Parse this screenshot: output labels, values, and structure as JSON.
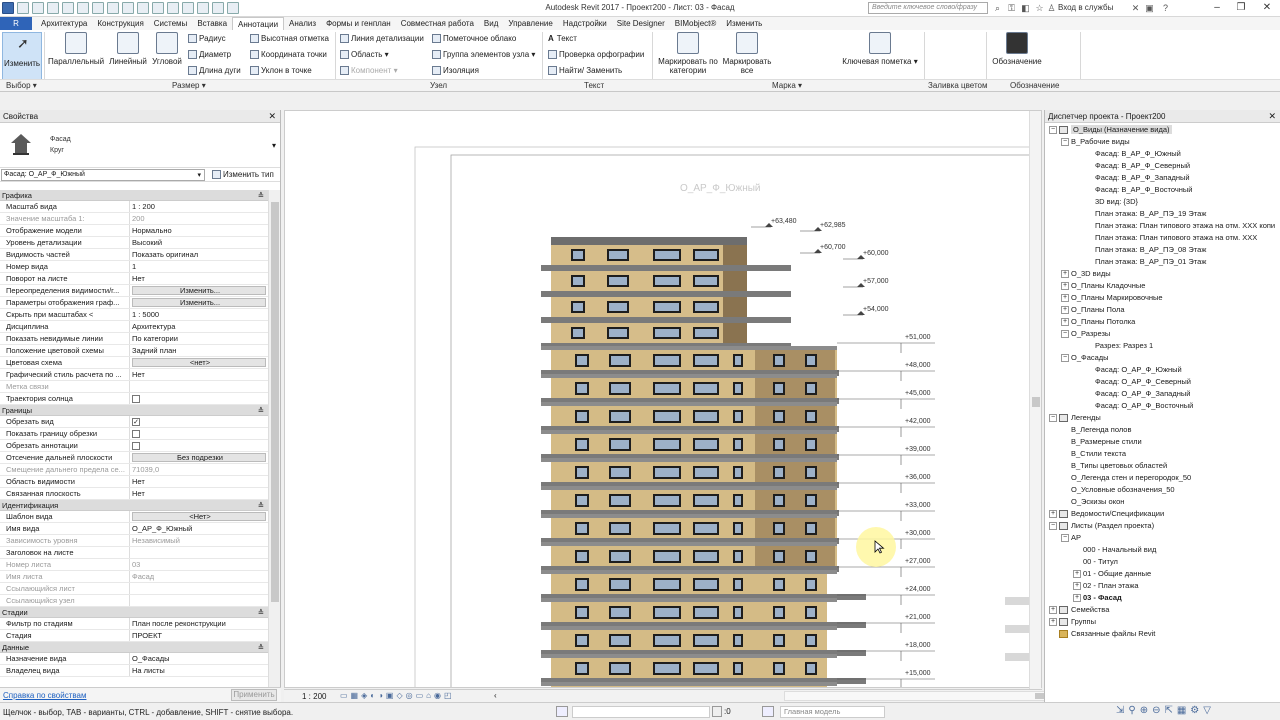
{
  "window": {
    "title": "Autodesk Revit 2017 -    Проект200 - Лист: 03 - Фасад",
    "search_placeholder": "Введите ключевое слово/фразу",
    "sign_in": "Вход в службы"
  },
  "file_tab": "R",
  "tabs": [
    "Архитектура",
    "Конструкция",
    "Системы",
    "Вставка",
    "Аннотации",
    "Анализ",
    "Формы и генплан",
    "Совместная работа",
    "Вид",
    "Управление",
    "Надстройки",
    "Site Designer",
    "BIMobject®",
    "Изменить"
  ],
  "active_tab": "Аннотации",
  "ribbon": {
    "modify": "Изменить",
    "dimension_buttons": [
      "Параллельный",
      "Линейный",
      "Угловой"
    ],
    "dim_small": [
      "Радиус",
      "Диаметр",
      "Длина дуги"
    ],
    "spot_small": [
      "Высотная отметка",
      "Координата точки",
      "Уклон  в точке"
    ],
    "detail_small": [
      "Линия детализации",
      "Область",
      "Компонент"
    ],
    "detail_small2": [
      "Пометочное облако",
      "Группа элементов узла",
      "Изоляция"
    ],
    "text_small": [
      "Текст",
      "Проверка  орфографии",
      "Найти/ Заменить"
    ],
    "tag_big": [
      "Маркировать по категории",
      "Маркировать все"
    ],
    "keynote": "Ключевая пометка",
    "legend": "Обозначение",
    "panels": {
      "select": "Выбор",
      "dimension": "Размер",
      "detail": "Узел",
      "text": "Текст",
      "tag": "Марка",
      "color_fill": "Заливка цветом",
      "symbol": "Обозначение"
    }
  },
  "properties": {
    "title": "Свойства",
    "type_line1": "Фасад",
    "type_line2": "Круг",
    "instance": "Фасад: О_АР_Ф_Южный",
    "edit_type": "Изменить тип",
    "help_link": "Справка по свойствам",
    "apply": "Применить",
    "sections": [
      {
        "name": "Графика",
        "rows": [
          {
            "n": "Масштаб вида",
            "v": "1 : 200"
          },
          {
            "n": "Значение масштаба    1:",
            "v": "200",
            "gray": true
          },
          {
            "n": "Отображение модели",
            "v": "Нормально"
          },
          {
            "n": "Уровень детализации",
            "v": "Высокий"
          },
          {
            "n": "Видимость частей",
            "v": "Показать оригинал"
          },
          {
            "n": "Номер вида",
            "v": "1"
          },
          {
            "n": "Поворот на листе",
            "v": "Нет"
          },
          {
            "n": "Переопределения видимости/г...",
            "v": "Изменить...",
            "btn": true
          },
          {
            "n": "Параметры отображения граф...",
            "v": "Изменить...",
            "btn": true
          },
          {
            "n": "Скрыть при масштабах <",
            "v": "1 : 5000"
          },
          {
            "n": "Дисциплина",
            "v": "Архитектура"
          },
          {
            "n": "Показать невидимые линии",
            "v": "По категории"
          },
          {
            "n": "Положение цветовой схемы",
            "v": "Задний план"
          },
          {
            "n": "Цветовая схема",
            "v": "<нет>",
            "btn": true
          },
          {
            "n": "Графический стиль расчета по ...",
            "v": "Нет"
          },
          {
            "n": "Метка связи",
            "v": "",
            "gray": true
          },
          {
            "n": "Траектория солнца",
            "v": "",
            "chk": false
          }
        ]
      },
      {
        "name": "Границы",
        "rows": [
          {
            "n": "Обрезать вид",
            "v": "",
            "chk": true
          },
          {
            "n": "Показать границу обрезки",
            "v": "",
            "chk": false
          },
          {
            "n": "Обрезать аннотации",
            "v": "",
            "chk": false
          },
          {
            "n": "Отсечение дальней плоскости",
            "v": "Без подрезки",
            "btn": true
          },
          {
            "n": "Смещение дальнего предела се...",
            "v": "71039,0",
            "gray": true
          },
          {
            "n": "Область видимости",
            "v": "Нет"
          },
          {
            "n": "Связанная плоскость",
            "v": "Нет"
          }
        ]
      },
      {
        "name": "Идентификация",
        "rows": [
          {
            "n": "Шаблон вида",
            "v": "<Нет>",
            "btn": true
          },
          {
            "n": "Имя вида",
            "v": "О_АР_Ф_Южный"
          },
          {
            "n": "Зависимость уровня",
            "v": "Независимый",
            "gray": true
          },
          {
            "n": "Заголовок на листе",
            "v": ""
          },
          {
            "n": "Номер листа",
            "v": "03",
            "gray": true
          },
          {
            "n": "Имя листа",
            "v": "Фасад",
            "gray": true
          },
          {
            "n": "Ссылающийся лист",
            "v": "",
            "gray": true
          },
          {
            "n": "Ссылающийся узел",
            "v": "",
            "gray": true
          }
        ]
      },
      {
        "name": "Стадии",
        "rows": [
          {
            "n": "Фильтр по стадиям",
            "v": "План после реконструкции"
          },
          {
            "n": "Стадия",
            "v": "ПРОЕКТ"
          }
        ]
      },
      {
        "name": "Данные",
        "rows": [
          {
            "n": "Назначение вида",
            "v": "О_Фасады"
          },
          {
            "n": "Владелец вида",
            "v": "На листы"
          }
        ]
      }
    ]
  },
  "drawing": {
    "view_title": "О_АР_Ф_Южный",
    "levels_upper": [
      "+63,480",
      "+62,985",
      "+60,700",
      "+60,000",
      "+57,000",
      "+54,000"
    ],
    "levels_lower": [
      "+51,000",
      "+48,000",
      "+45,000",
      "+42,000",
      "+39,000",
      "+36,000",
      "+33,000",
      "+30,000",
      "+27,000",
      "+24,000",
      "+21,000",
      "+18,000",
      "+15,000"
    ],
    "scale": "1 : 200"
  },
  "browser": {
    "title": "Диспетчер проекта - Проект200",
    "items": [
      {
        "t": "О_Виды (Назначение вида)",
        "lvl": 0,
        "tog": "-",
        "ico": true,
        "sel": true
      },
      {
        "t": "В_Рабочие виды",
        "lvl": 1,
        "tog": "-"
      },
      {
        "t": "Фасад: В_АР_Ф_Южный",
        "lvl": 3
      },
      {
        "t": "Фасад: В_АР_Ф_Северный",
        "lvl": 3
      },
      {
        "t": "Фасад: В_АР_Ф_Западный",
        "lvl": 3
      },
      {
        "t": "Фасад: В_АР_Ф_Восточный",
        "lvl": 3
      },
      {
        "t": "3D вид: {3D}",
        "lvl": 3
      },
      {
        "t": "План этажа: В_АР_ПЭ_19 Этаж",
        "lvl": 3
      },
      {
        "t": "План этажа: План типового этажа на отм. XXX копи",
        "lvl": 3
      },
      {
        "t": "План этажа: План типового этажа на отм. XXX",
        "lvl": 3
      },
      {
        "t": "План этажа: В_АР_ПЭ_08 Этаж",
        "lvl": 3
      },
      {
        "t": "План этажа: В_АР_ПЭ_01 Этаж",
        "lvl": 3
      },
      {
        "t": "О_3D виды",
        "lvl": 1,
        "tog": "+"
      },
      {
        "t": "О_Планы Кладочные",
        "lvl": 1,
        "tog": "+"
      },
      {
        "t": "О_Планы Маркировочные",
        "lvl": 1,
        "tog": "+"
      },
      {
        "t": "О_Планы Пола",
        "lvl": 1,
        "tog": "+"
      },
      {
        "t": "О_Планы Потолка",
        "lvl": 1,
        "tog": "+"
      },
      {
        "t": "О_Разрезы",
        "lvl": 1,
        "tog": "-"
      },
      {
        "t": "Разрез: Разрез 1",
        "lvl": 3
      },
      {
        "t": "О_Фасады",
        "lvl": 1,
        "tog": "-"
      },
      {
        "t": "Фасад: О_АР_Ф_Южный",
        "lvl": 3
      },
      {
        "t": "Фасад: О_АР_Ф_Северный",
        "lvl": 3
      },
      {
        "t": "Фасад: О_АР_Ф_Западный",
        "lvl": 3
      },
      {
        "t": "Фасад: О_АР_Ф_Восточный",
        "lvl": 3
      },
      {
        "t": "Легенды",
        "lvl": 0,
        "tog": "-",
        "ico": true
      },
      {
        "t": "В_Легенда полов",
        "lvl": 1
      },
      {
        "t": "В_Размерные стили",
        "lvl": 1
      },
      {
        "t": "В_Стили текста",
        "lvl": 1
      },
      {
        "t": "В_Типы цветовых областей",
        "lvl": 1
      },
      {
        "t": "О_Легенда стен и перегородок_50",
        "lvl": 1
      },
      {
        "t": "О_Условные обозначения_50",
        "lvl": 1
      },
      {
        "t": "О_Эскизы окон",
        "lvl": 1
      },
      {
        "t": "Ведомости/Спецификации",
        "lvl": 0,
        "tog": "+",
        "ico": true
      },
      {
        "t": "Листы (Раздел проекта)",
        "lvl": 0,
        "tog": "-",
        "ico": true
      },
      {
        "t": "АР",
        "lvl": 1,
        "tog": "-"
      },
      {
        "t": "000 - Начальный вид",
        "lvl": 2
      },
      {
        "t": "00 - Титул",
        "lvl": 2
      },
      {
        "t": "01 - Общие данные",
        "lvl": 2,
        "tog": "+"
      },
      {
        "t": "02 - План этажа",
        "lvl": 2,
        "tog": "+"
      },
      {
        "t": "03 - Фасад",
        "lvl": 2,
        "tog": "+",
        "bold": true
      },
      {
        "t": "Семейства",
        "lvl": 0,
        "tog": "+",
        "ico": true
      },
      {
        "t": "Группы",
        "lvl": 0,
        "tog": "+",
        "ico": true
      },
      {
        "t": "Связанные файлы Revit",
        "lvl": 0,
        "link": true
      }
    ]
  },
  "status": {
    "text": "Щелчок - выбор, TAB - варианты, CTRL - добавление, SHIFT - снятие выбора.",
    "zero": ":0",
    "model": "Главная модель"
  }
}
